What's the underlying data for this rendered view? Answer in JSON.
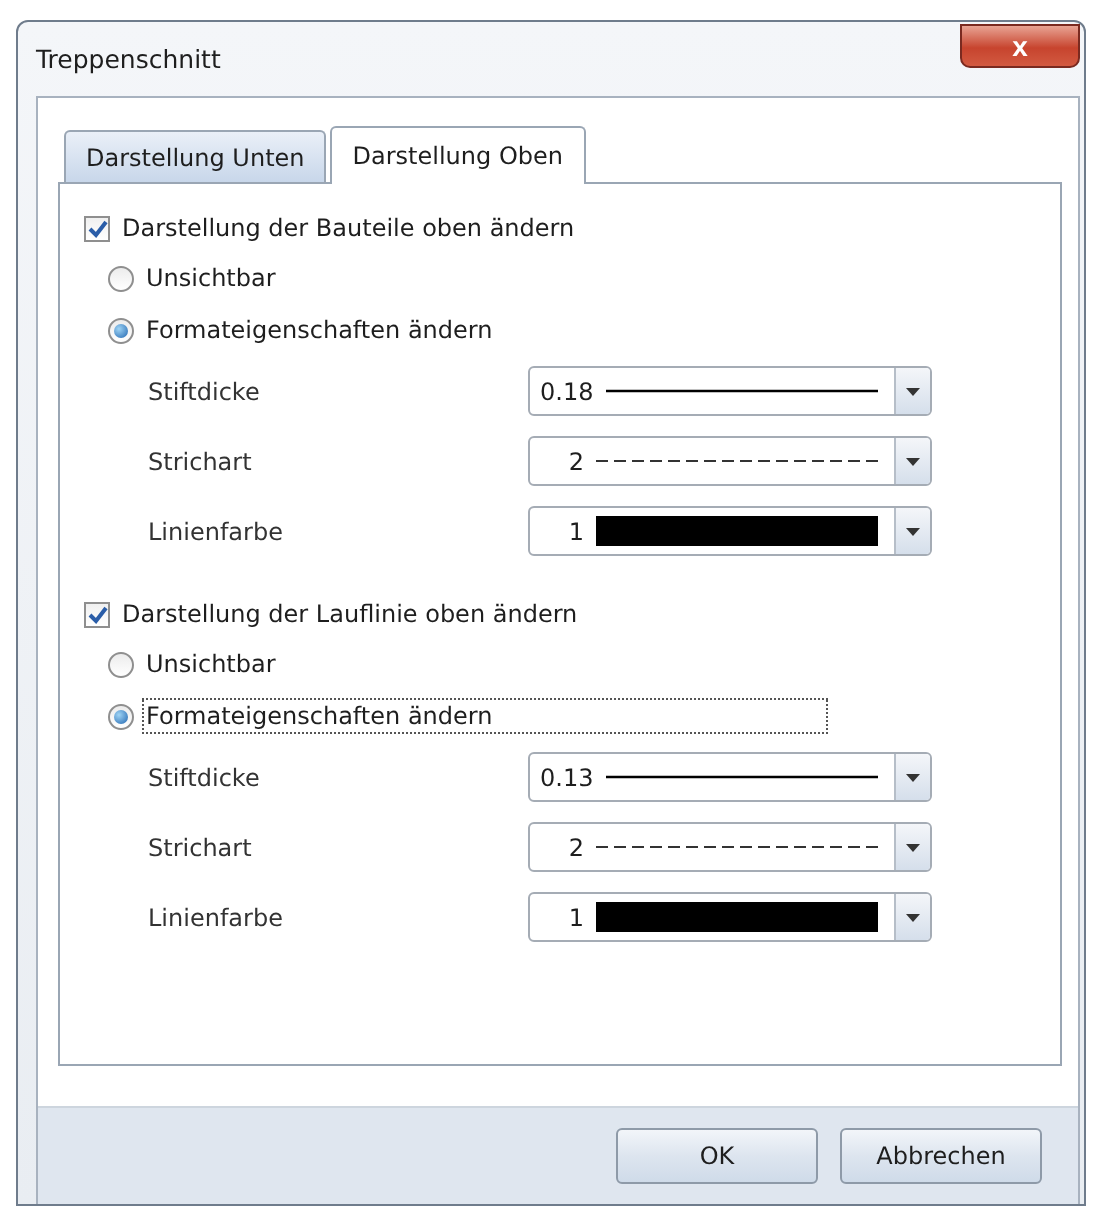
{
  "window": {
    "title": "Treppenschnitt",
    "close_label": "x"
  },
  "tabs": [
    {
      "label": "Darstellung Unten",
      "selected": false
    },
    {
      "label": "Darstellung Oben",
      "selected": true
    }
  ],
  "sections": [
    {
      "label": "Darstellung der Bauteile oben ändern",
      "checked": true,
      "options": [
        {
          "label": "Unsichtbar",
          "selected": false,
          "focused": false
        },
        {
          "label": "Formateigenschaften ändern",
          "selected": true,
          "focused": false
        }
      ],
      "fields": [
        {
          "label": "Stiftdicke",
          "kind": "line",
          "value": "0.18"
        },
        {
          "label": "Strichart",
          "kind": "dash",
          "value": "2"
        },
        {
          "label": "Linienfarbe",
          "kind": "color",
          "value": "1",
          "color": "#000000"
        }
      ]
    },
    {
      "label": "Darstellung der Lauflinie oben ändern",
      "checked": true,
      "options": [
        {
          "label": "Unsichtbar",
          "selected": false,
          "focused": false
        },
        {
          "label": "Formateigenschaften ändern",
          "selected": true,
          "focused": true
        }
      ],
      "fields": [
        {
          "label": "Stiftdicke",
          "kind": "line",
          "value": "0.13"
        },
        {
          "label": "Strichart",
          "kind": "dash",
          "value": "2"
        },
        {
          "label": "Linienfarbe",
          "kind": "color",
          "value": "1",
          "color": "#000000"
        }
      ]
    }
  ],
  "buttons": [
    "OK",
    "Abbrechen"
  ]
}
